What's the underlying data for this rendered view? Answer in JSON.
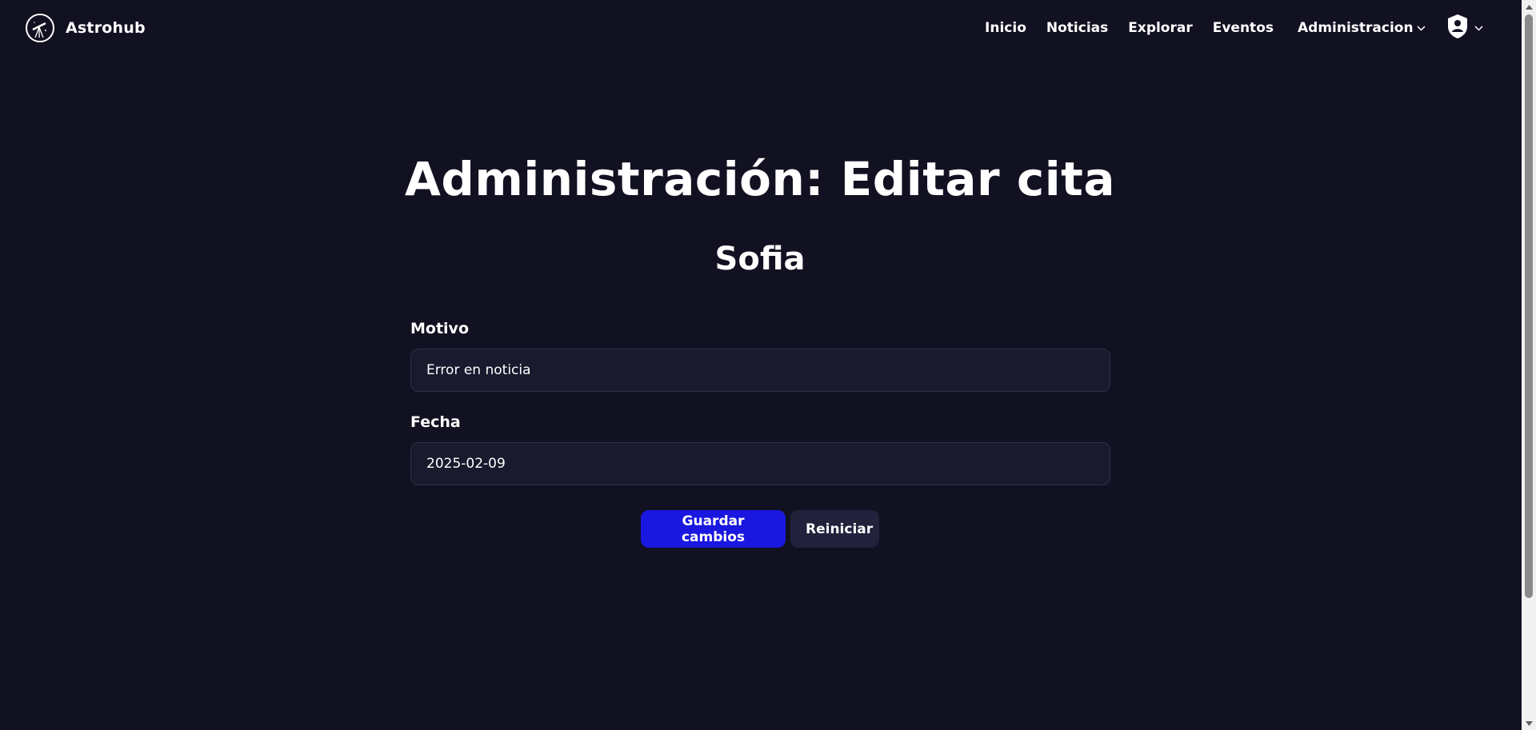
{
  "brand": {
    "name": "Astrohub",
    "logo_icon": "telescope-icon"
  },
  "nav": {
    "links": [
      "Inicio",
      "Noticias",
      "Explorar",
      "Eventos"
    ],
    "admin_label": "Administracion",
    "user_icon": "user-shield-icon"
  },
  "page": {
    "title": "Administración: Editar cita",
    "subtitle": "Sofia"
  },
  "form": {
    "motivo": {
      "label": "Motivo",
      "value": "Error en noticia"
    },
    "fecha": {
      "label": "Fecha",
      "value": "2025-02-09"
    }
  },
  "actions": {
    "save_label": "Guardar cambios",
    "reset_label": "Reiniciar"
  },
  "colors": {
    "background": "#111122",
    "primary_button": "#1a17e0",
    "secondary_button": "#22223c",
    "input_background": "#191a2e"
  }
}
